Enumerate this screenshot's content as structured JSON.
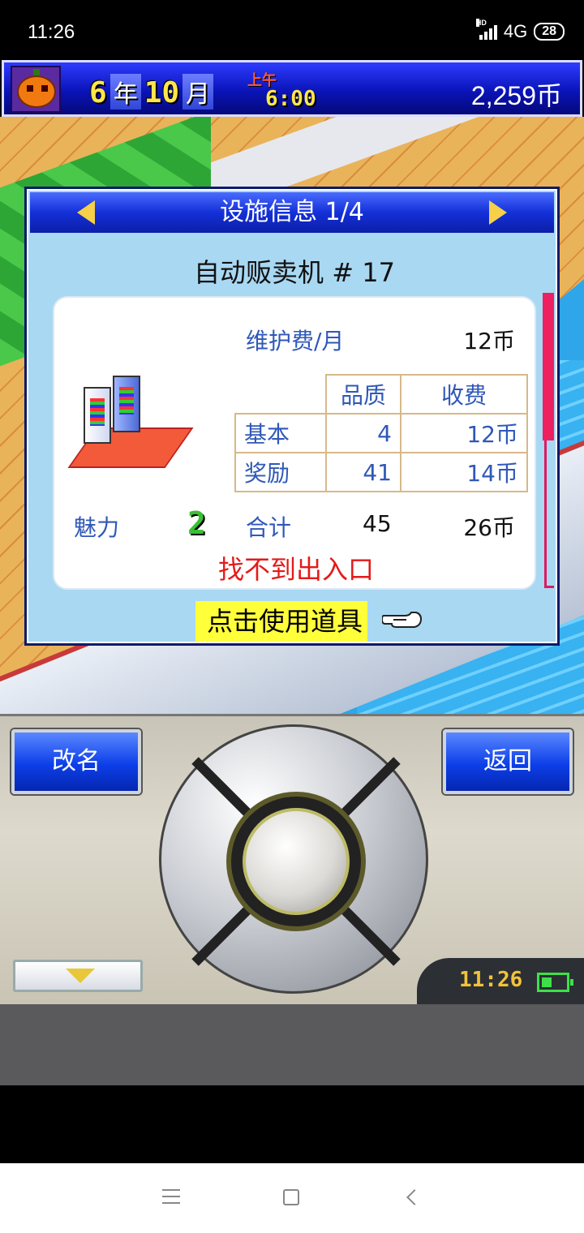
{
  "status_bar": {
    "time": "11:26",
    "network": "4G",
    "hd": "HD",
    "battery": "28"
  },
  "hud": {
    "year_num": "6",
    "year_unit": "年",
    "month_num": "10",
    "month_unit": "月",
    "ampm": "上午",
    "clock": "6:00",
    "money": "2,259币"
  },
  "dialog": {
    "title": "设施信息 1/4",
    "facility_name": "自动贩卖机 # 17",
    "maintenance_label": "维护费/月",
    "maintenance_value": "12币",
    "table": {
      "headers": [
        "品质",
        "收费"
      ],
      "rows": [
        {
          "label": "基本",
          "quality": "4",
          "fee": "12币"
        },
        {
          "label": "奖励",
          "quality": "41",
          "fee": "14币"
        }
      ]
    },
    "charm_label": "魅力",
    "charm_value": "2",
    "total_label": "合计",
    "total_quality": "45",
    "total_fee": "26币",
    "warning": "找不到出入口",
    "use_item": "点击使用道具"
  },
  "controls": {
    "rename": "改名",
    "back": "返回",
    "clock": "11:26"
  },
  "colors": {
    "accent_blue": "#0d3fe8",
    "warning_red": "#e31a1a",
    "panel_bg": "#a9d8f2",
    "highlight_yellow": "#ffff3a"
  }
}
